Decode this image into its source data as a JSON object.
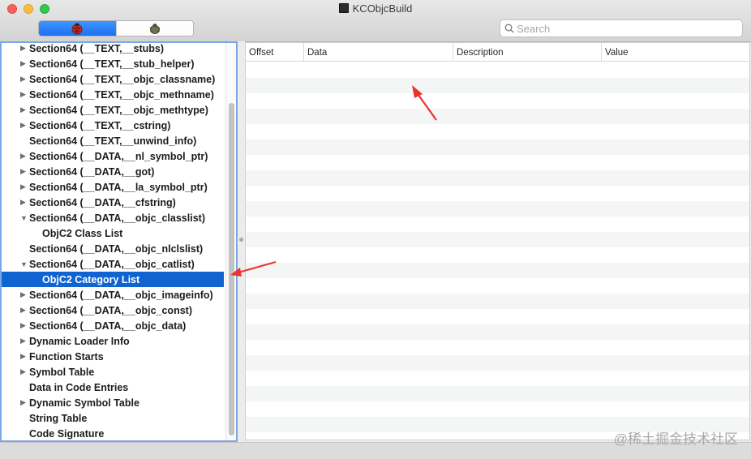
{
  "window": {
    "title": "KCObjcBuild"
  },
  "toolbar": {
    "segments": [
      {
        "name": "mach-o-view",
        "icon": "ladybug-icon"
      },
      {
        "name": "raw-view",
        "icon": "beetle-icon"
      }
    ],
    "search_placeholder": "Search"
  },
  "outline": {
    "items": [
      {
        "label": "Section64 (__TEXT,__stubs)",
        "depth": 1,
        "disclosure": "collapsed"
      },
      {
        "label": "Section64 (__TEXT,__stub_helper)",
        "depth": 1,
        "disclosure": "collapsed"
      },
      {
        "label": "Section64 (__TEXT,__objc_classname)",
        "depth": 1,
        "disclosure": "collapsed"
      },
      {
        "label": "Section64 (__TEXT,__objc_methname)",
        "depth": 1,
        "disclosure": "collapsed"
      },
      {
        "label": "Section64 (__TEXT,__objc_methtype)",
        "depth": 1,
        "disclosure": "collapsed"
      },
      {
        "label": "Section64 (__TEXT,__cstring)",
        "depth": 1,
        "disclosure": "collapsed"
      },
      {
        "label": "Section64 (__TEXT,__unwind_info)",
        "depth": 1,
        "disclosure": "none"
      },
      {
        "label": "Section64 (__DATA,__nl_symbol_ptr)",
        "depth": 1,
        "disclosure": "collapsed"
      },
      {
        "label": "Section64 (__DATA,__got)",
        "depth": 1,
        "disclosure": "collapsed"
      },
      {
        "label": "Section64 (__DATA,__la_symbol_ptr)",
        "depth": 1,
        "disclosure": "collapsed"
      },
      {
        "label": "Section64 (__DATA,__cfstring)",
        "depth": 1,
        "disclosure": "collapsed"
      },
      {
        "label": "Section64 (__DATA,__objc_classlist)",
        "depth": 1,
        "disclosure": "expanded"
      },
      {
        "label": "ObjC2 Class List",
        "depth": 2,
        "disclosure": "none"
      },
      {
        "label": "Section64 (__DATA,__objc_nlclslist)",
        "depth": 1,
        "disclosure": "none"
      },
      {
        "label": "Section64 (__DATA,__objc_catlist)",
        "depth": 1,
        "disclosure": "expanded"
      },
      {
        "label": "ObjC2 Category List",
        "depth": 2,
        "disclosure": "none",
        "selected": true
      },
      {
        "label": "Section64 (__DATA,__objc_imageinfo)",
        "depth": 1,
        "disclosure": "collapsed"
      },
      {
        "label": "Section64 (__DATA,__objc_const)",
        "depth": 1,
        "disclosure": "collapsed"
      },
      {
        "label": "Section64 (__DATA,__objc_data)",
        "depth": 1,
        "disclosure": "collapsed"
      },
      {
        "label": "Dynamic Loader Info",
        "depth": 1,
        "disclosure": "collapsed"
      },
      {
        "label": "Function Starts",
        "depth": 1,
        "disclosure": "collapsed"
      },
      {
        "label": "Symbol Table",
        "depth": 1,
        "disclosure": "collapsed"
      },
      {
        "label": "Data in Code Entries",
        "depth": 1,
        "disclosure": "none"
      },
      {
        "label": "Dynamic Symbol Table",
        "depth": 1,
        "disclosure": "collapsed"
      },
      {
        "label": "String Table",
        "depth": 1,
        "disclosure": "none"
      },
      {
        "label": "Code Signature",
        "depth": 1,
        "disclosure": "none"
      }
    ]
  },
  "table": {
    "columns": [
      "Offset",
      "Data",
      "Description",
      "Value"
    ],
    "rows": []
  },
  "watermark": "@稀土掘金技术社区",
  "colors": {
    "selection": "#0f64d2",
    "focus_ring": "#7aa7e6",
    "annotation_arrow": "#e8352b"
  }
}
